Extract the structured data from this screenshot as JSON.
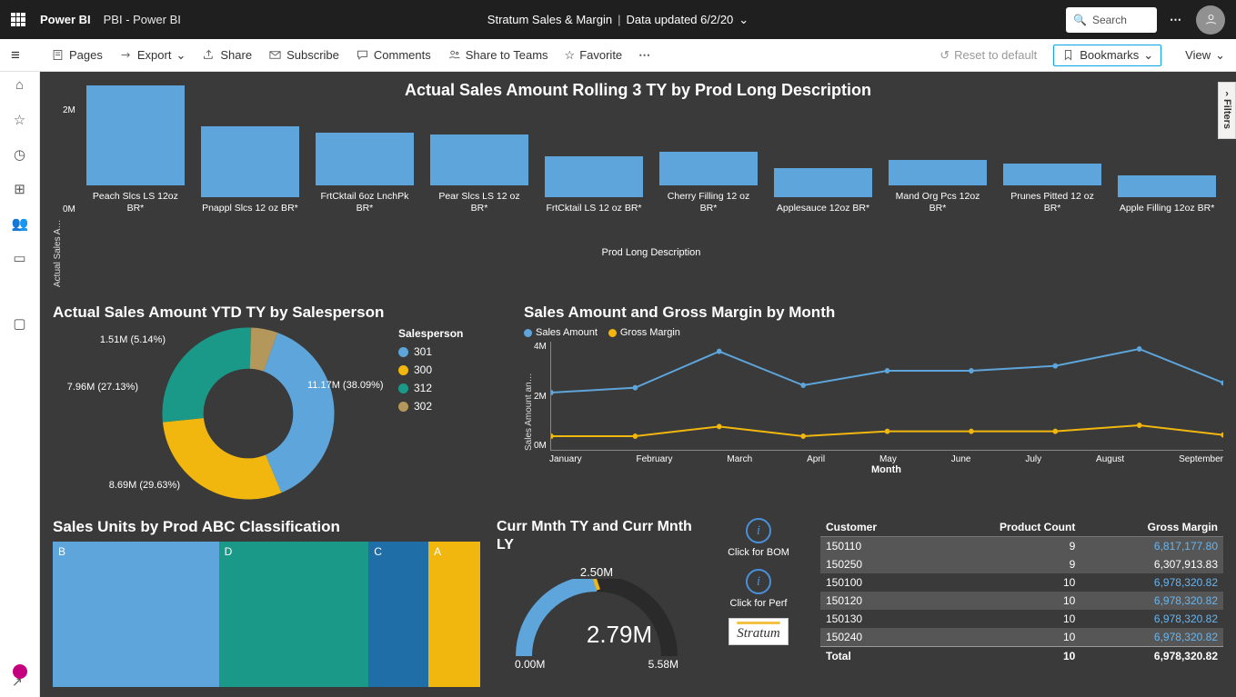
{
  "header": {
    "app": "Power BI",
    "workspace": "PBI - Power BI",
    "report": "Stratum Sales & Margin",
    "updated": "Data updated 6/2/20",
    "search_placeholder": "Search"
  },
  "toolbar": {
    "pages": "Pages",
    "export": "Export",
    "share": "Share",
    "subscribe": "Subscribe",
    "comments": "Comments",
    "share_teams": "Share to Teams",
    "favorite": "Favorite",
    "reset": "Reset to default",
    "bookmarks": "Bookmarks",
    "view": "View"
  },
  "filters_label": "Filters",
  "chart_data": [
    {
      "id": "bar_top",
      "type": "bar",
      "title": "Actual Sales Amount Rolling 3 TY by Prod Long Description",
      "ylabel": "Actual Sales A…",
      "xlabel": "Prod Long Description",
      "y_ticks": [
        "2M",
        "0M"
      ],
      "categories": [
        "Peach Slcs LS 12oz BR*",
        "Pnappl Slcs 12 oz BR*",
        "FrtCktail 6oz LnchPk BR*",
        "Pear Slcs LS 12 oz BR*",
        "FrtCktail LS 12 oz BR*",
        "Cherry Filling 12 oz BR*",
        "Applesauce 12oz BR*",
        "Mand Org Pcs 12oz BR*",
        "Prunes Pitted 12 oz BR*",
        "Apple Filling 12oz BR*"
      ],
      "values": [
        2.55,
        1.8,
        1.35,
        1.3,
        1.05,
        0.85,
        0.75,
        0.65,
        0.55,
        0.55
      ]
    },
    {
      "id": "donut",
      "type": "pie",
      "title": "Actual Sales Amount YTD TY by Salesperson",
      "legend_title": "Salesperson",
      "slices": [
        {
          "name": "301",
          "value": 11.17,
          "pct": 38.09,
          "label": "11.17M (38.09%)",
          "color": "#5da5da"
        },
        {
          "name": "300",
          "value": 8.69,
          "pct": 29.63,
          "label": "8.69M (29.63%)",
          "color": "#f1b70e"
        },
        {
          "name": "312",
          "value": 7.96,
          "pct": 27.13,
          "label": "7.96M (27.13%)",
          "color": "#1a9988"
        },
        {
          "name": "302",
          "value": 1.51,
          "pct": 5.14,
          "label": "1.51M (5.14%)",
          "color": "#b4975a"
        }
      ]
    },
    {
      "id": "line",
      "type": "line",
      "title": "Sales Amount and Gross Margin by Month",
      "ylabel": "Sales Amount an…",
      "xlabel": "Month",
      "y_ticks": [
        "4M",
        "2M",
        "0M"
      ],
      "x": [
        "January",
        "February",
        "March",
        "April",
        "May",
        "June",
        "July",
        "August",
        "September"
      ],
      "series": [
        {
          "name": "Sales Amount",
          "color": "#5da5da",
          "values": [
            2.4,
            2.6,
            4.1,
            2.7,
            3.3,
            3.3,
            3.5,
            4.2,
            2.8
          ]
        },
        {
          "name": "Gross Margin",
          "color": "#f1b70e",
          "values": [
            0.6,
            0.6,
            1.0,
            0.6,
            0.8,
            0.8,
            0.8,
            1.05,
            0.65
          ]
        }
      ]
    },
    {
      "id": "treemap",
      "type": "area",
      "title": "Sales Units by Prod ABC Classification",
      "slices": [
        {
          "name": "B",
          "value": 38,
          "color": "#5da5da"
        },
        {
          "name": "D",
          "value": 34,
          "color": "#1a9988"
        },
        {
          "name": "C",
          "value": 12,
          "color": "#1f6ea7"
        },
        {
          "name": "A",
          "value": 10,
          "color": "#f1b70e"
        }
      ]
    },
    {
      "id": "gauge",
      "type": "bar",
      "title": "Curr Mnth TY and Curr Mnth LY",
      "value": 2.79,
      "target": 2.5,
      "min": 0.0,
      "max": 5.58,
      "labels": {
        "value": "2.79M",
        "target": "2.50M",
        "min": "0.00M",
        "max": "5.58M"
      }
    },
    {
      "id": "table",
      "type": "table",
      "columns": [
        "Customer",
        "Product Count",
        "Gross Margin"
      ],
      "rows": [
        {
          "customer": "150110",
          "count": 9,
          "margin": "6,817,177.80",
          "hl": true,
          "link": true
        },
        {
          "customer": "150250",
          "count": 9,
          "margin": "6,307,913.83",
          "hl": true,
          "link": false
        },
        {
          "customer": "150100",
          "count": 10,
          "margin": "6,978,320.82",
          "hl": false,
          "link": true
        },
        {
          "customer": "150120",
          "count": 10,
          "margin": "6,978,320.82",
          "hl": true,
          "link": true
        },
        {
          "customer": "150130",
          "count": 10,
          "margin": "6,978,320.82",
          "hl": false,
          "link": true
        },
        {
          "customer": "150240",
          "count": 10,
          "margin": "6,978,320.82",
          "hl": true,
          "link": true
        }
      ],
      "total": {
        "label": "Total",
        "count": 10,
        "margin": "6,978,320.82"
      }
    }
  ],
  "info_buttons": {
    "bom": "Click for BOM",
    "perf": "Click for Perf"
  },
  "logo": "Stratum"
}
